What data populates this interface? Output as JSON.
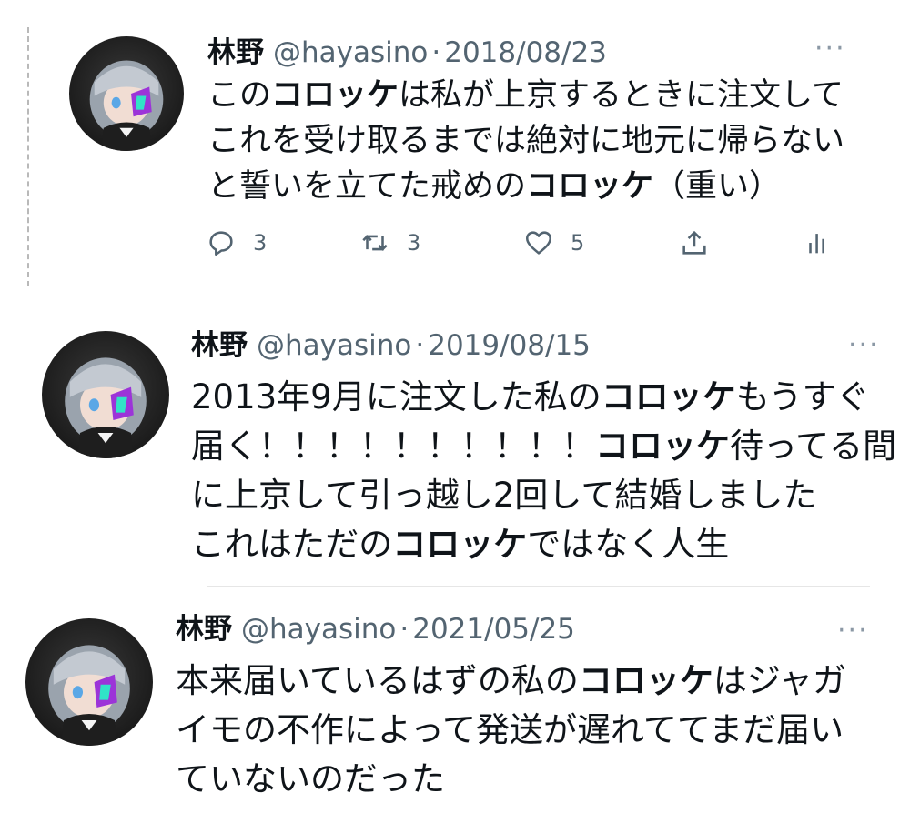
{
  "tweets": [
    {
      "name": "林野",
      "handle": "@hayasino",
      "dot": "·",
      "date": "2018/08/23",
      "more": "···",
      "lines": [
        [
          "この",
          "コロッケ",
          "は私が上京するときに注文して"
        ],
        [
          "これを受け取るまでは絶対に地元に帰らない"
        ],
        [
          "と誓いを立てた戒めの",
          "コロッケ",
          "（重い）"
        ]
      ],
      "actions": {
        "reply": "3",
        "retweet": "3",
        "like": "5"
      }
    },
    {
      "name": "林野",
      "handle": "@hayasino",
      "dot": "·",
      "date": "2019/08/15",
      "more": "···",
      "lines": [
        [
          "2013年9月に注文した私の",
          "コロッケ",
          "もうすぐ"
        ],
        [
          "届く！！！！！！！！！！",
          "コロッケ",
          "待ってる間"
        ],
        [
          "に上京して引っ越し2回して結婚しました"
        ],
        [
          "これはただの",
          "コロッケ",
          "ではなく人生"
        ]
      ]
    },
    {
      "name": "林野",
      "handle": "@hayasino",
      "dot": "·",
      "date": "2021/05/25",
      "more": "···",
      "lines": [
        [
          "本来届いているはずの私の",
          "コロッケ",
          "はジャガ"
        ],
        [
          "イモの不作によって発送が遅れててまだ届い"
        ],
        [
          "ていないのだった"
        ]
      ]
    }
  ],
  "icons": {
    "reply": "reply-icon",
    "retweet": "retweet-icon",
    "like": "heart-icon",
    "share": "share-icon",
    "analytics": "analytics-icon",
    "more": "more-icon"
  }
}
